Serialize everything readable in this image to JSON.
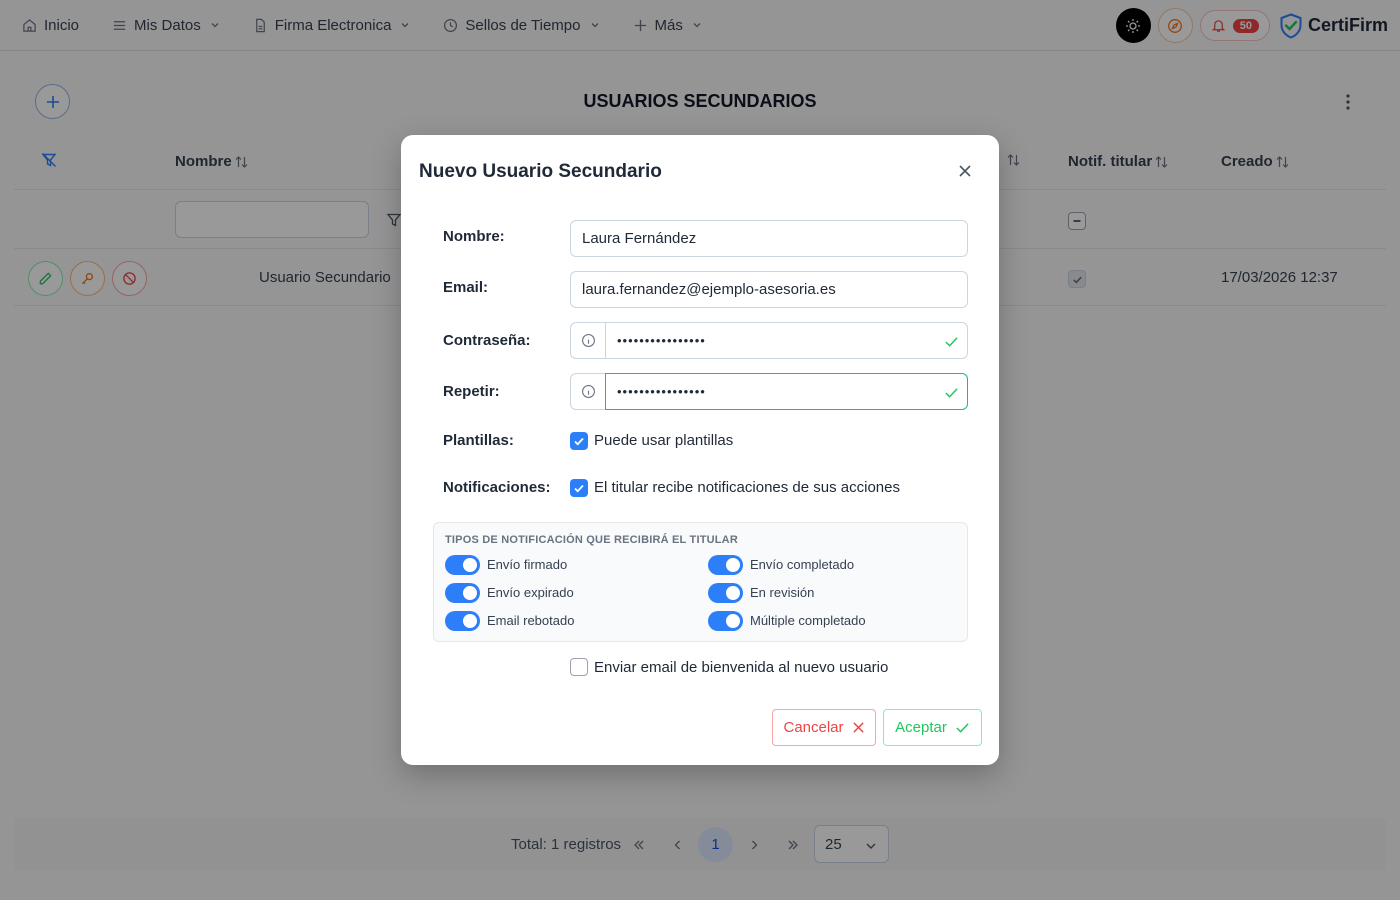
{
  "nav": {
    "items": [
      {
        "label": "Inicio",
        "icon": "home-icon",
        "has_dropdown": false
      },
      {
        "label": "Mis Datos",
        "icon": "list-icon",
        "has_dropdown": true
      },
      {
        "label": "Firma Electronica",
        "icon": "document-icon",
        "has_dropdown": true
      },
      {
        "label": "Sellos de Tiempo",
        "icon": "clock-icon",
        "has_dropdown": true
      },
      {
        "label": "Más",
        "icon": "plus-icon",
        "has_dropdown": true
      }
    ],
    "notification_count": "50",
    "brand": "CertiFirm"
  },
  "page": {
    "title": "USUARIOS SECUNDARIOS",
    "columns": {
      "nombre": "Nombre",
      "notif_titular": "Notif. titular",
      "creado": "Creado"
    },
    "row": {
      "nombre": "Usuario Secundario",
      "creado": "17/03/2026 12:37"
    }
  },
  "paginator": {
    "total": "Total: 1 registros",
    "current_page": "1",
    "page_size": "25"
  },
  "modal": {
    "title": "Nuevo Usuario Secundario",
    "labels": {
      "nombre": "Nombre:",
      "email": "Email:",
      "password": "Contraseña:",
      "repeat": "Repetir:",
      "plantillas": "Plantillas:",
      "notificaciones": "Notificaciones:"
    },
    "values": {
      "nombre": "Laura Fernández",
      "email": "laura.fernandez@ejemplo-asesoria.es",
      "password": "••••••••••••••••",
      "repeat": "••••••••••••••••"
    },
    "plantillas_text": "Puede usar plantillas",
    "notificaciones_text": "El titular recibe notificaciones de sus acciones",
    "notif_types_title": "TIPOS DE NOTIFICACIÓN QUE RECIBIRÁ EL TITULAR",
    "notif_types": [
      {
        "label": "Envío firmado",
        "on": true
      },
      {
        "label": "Envío completado",
        "on": true
      },
      {
        "label": "Envío expirado",
        "on": true
      },
      {
        "label": "En revisión",
        "on": true
      },
      {
        "label": "Email rebotado",
        "on": true
      },
      {
        "label": "Múltiple completado",
        "on": true
      }
    ],
    "welcome_text": "Enviar email de bienvenida al nuevo usuario",
    "cancel_label": "Cancelar",
    "accept_label": "Aceptar"
  },
  "colors": {
    "primary": "#2d7ff9",
    "success": "#22c55e",
    "danger": "#ef4444"
  }
}
